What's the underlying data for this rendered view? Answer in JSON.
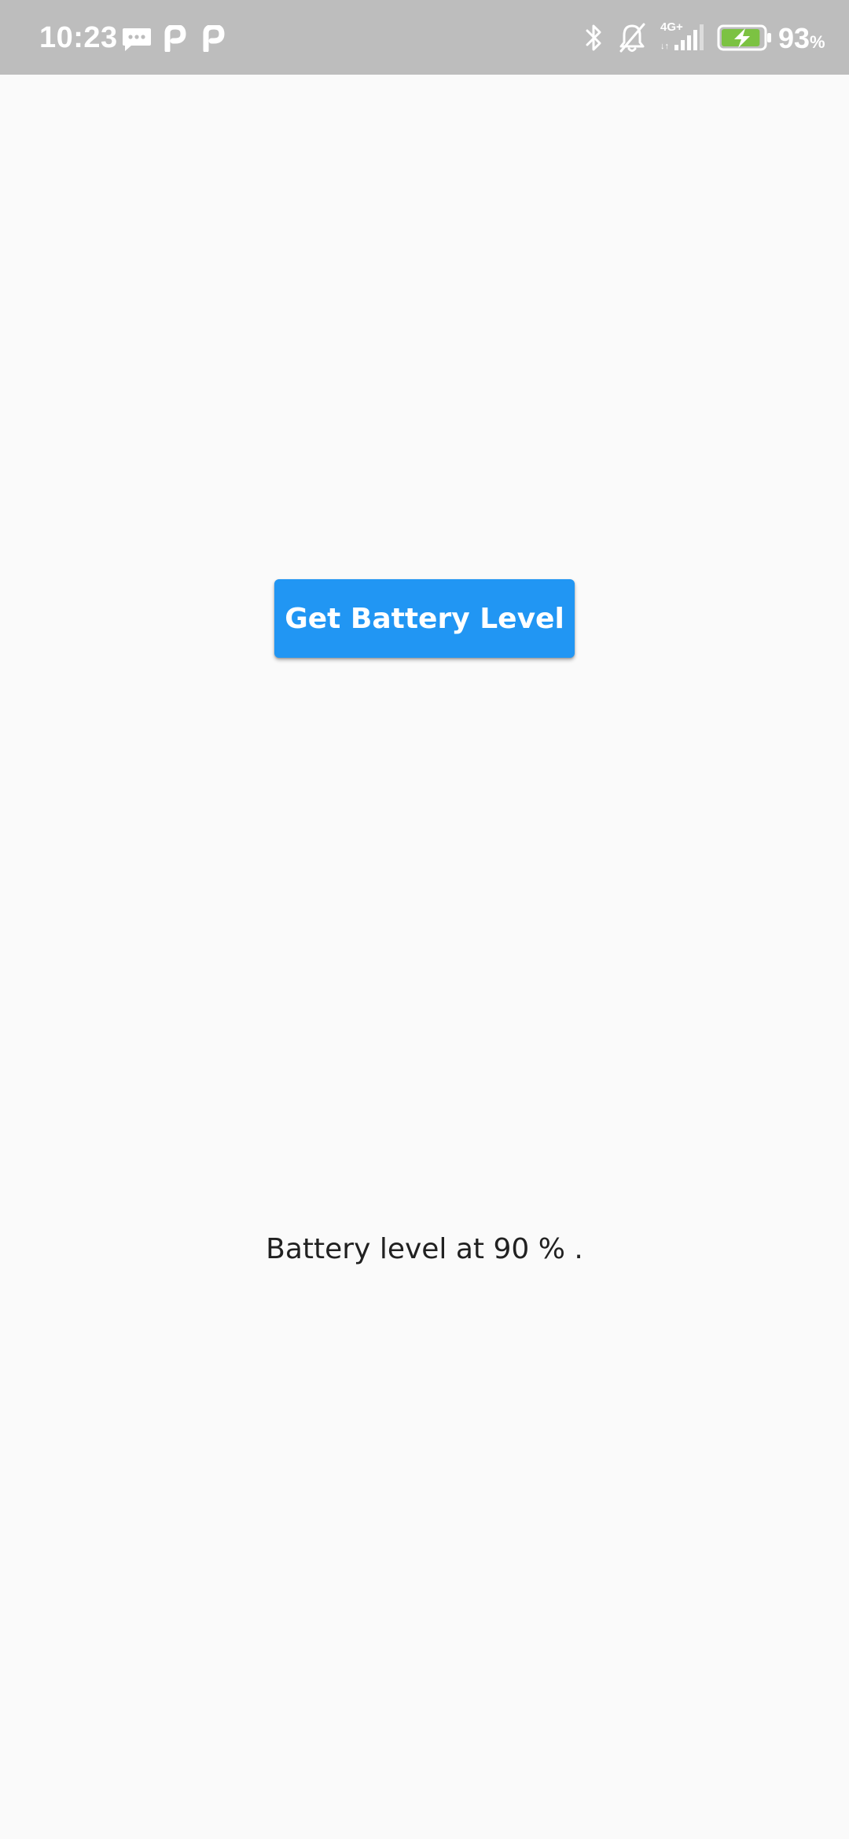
{
  "status_bar": {
    "time": "10:23",
    "left_icons": [
      "message-icon",
      "p-app-icon",
      "p-app-icon"
    ],
    "right_icons": [
      "bluetooth-icon",
      "bell-off-icon",
      "signal-4g-icon",
      "battery-charging-icon"
    ],
    "network_label": "4G+",
    "battery_percent": "93",
    "battery_percent_sign": "%",
    "battery_level": 0.93,
    "background_color": "#bdbdbd",
    "battery_fill_color": "#7cc242"
  },
  "main": {
    "button_label": "Get Battery Level",
    "button_color": "#2196f3",
    "result_text": "Battery level at 90 % ."
  }
}
